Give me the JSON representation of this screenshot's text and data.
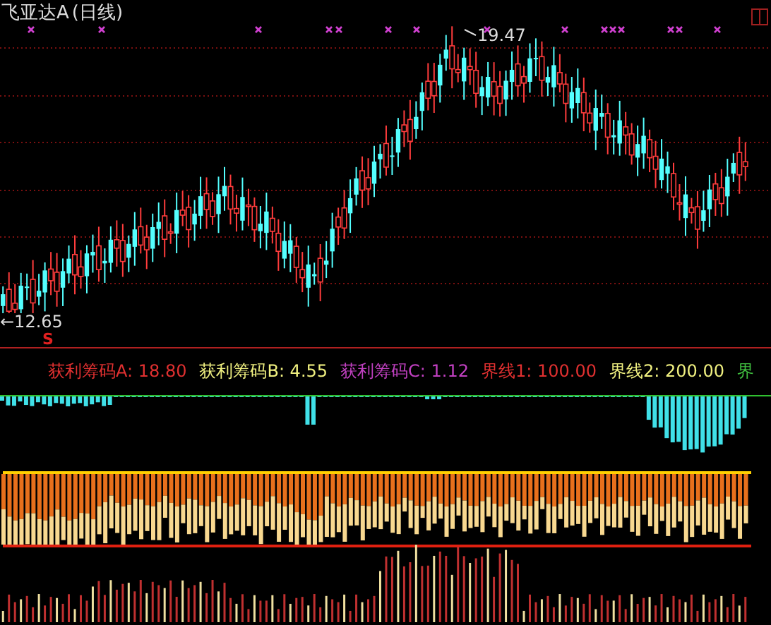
{
  "title": "飞亚达A",
  "period": "(日线)",
  "price_chart": {
    "high_label": "19.47",
    "low_label": "←12.65",
    "signal_mark": "S"
  },
  "indicator_legend": [
    {
      "text": "获利筹码A: 18.80",
      "color": "#e03030"
    },
    {
      "text": "获利筹码B: 4.55",
      "color": "#f0f080"
    },
    {
      "text": "获利筹码C: 1.12",
      "color": "#c040c0"
    },
    {
      "text": "界线1: 100.00",
      "color": "#e03030"
    },
    {
      "text": "界线2: 200.00",
      "color": "#f0f080"
    },
    {
      "text": "界",
      "color": "#40c040"
    }
  ]
}
